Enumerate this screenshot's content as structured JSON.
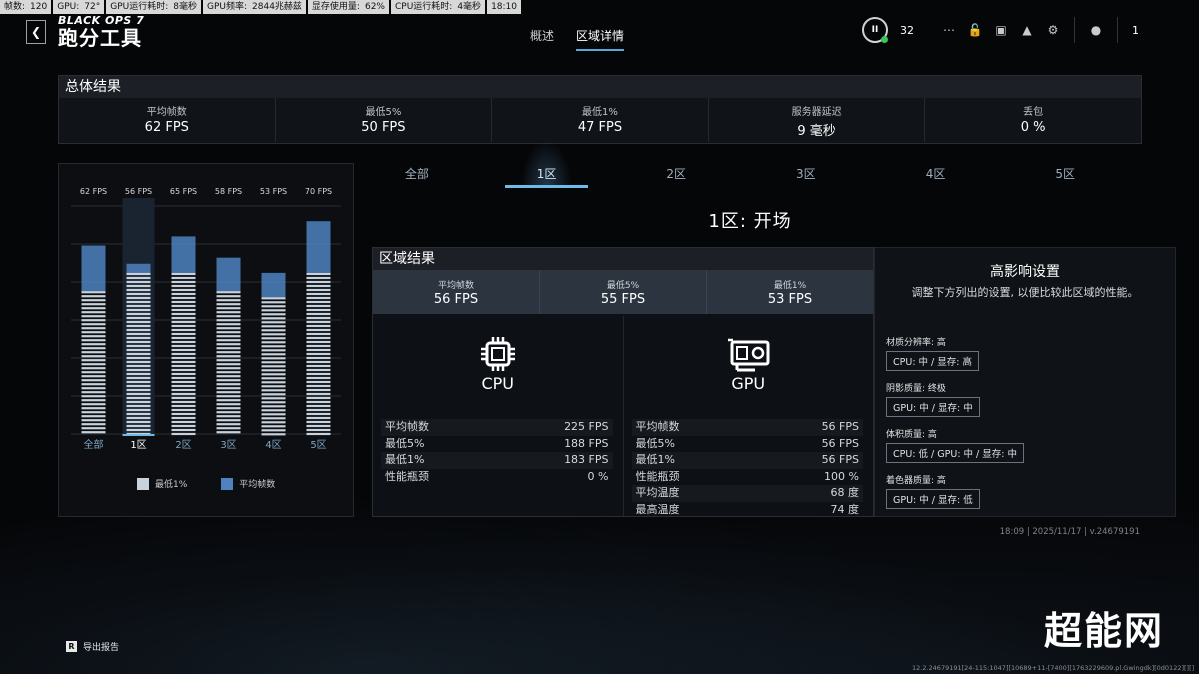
{
  "perf_overlay": [
    {
      "label": "帧数:",
      "value": "120"
    },
    {
      "label": "GPU:",
      "value": "72°"
    },
    {
      "label": "GPU运行耗时:",
      "value": "8毫秒"
    },
    {
      "label": "GPU频率:",
      "value": "2844兆赫兹"
    },
    {
      "label": "显存使用量:",
      "value": "62%"
    },
    {
      "label": "CPU运行耗时:",
      "value": "4毫秒"
    },
    {
      "label": "",
      "value": "18:10"
    }
  ],
  "header": {
    "brand": "BLACK OPS 7",
    "title": "跑分工具",
    "back_icon": "chevron-left-icon",
    "tabs": [
      {
        "label": "概述",
        "active": false
      },
      {
        "label": "区域详情",
        "active": true
      }
    ],
    "rank_badge": "II",
    "rank_number": "32",
    "icons": [
      "grid-icon",
      "lock-icon",
      "camera-icon",
      "bell-icon",
      "gear-icon"
    ],
    "party_count": "1"
  },
  "overall": {
    "title": "总体结果",
    "stats": [
      {
        "label": "平均帧数",
        "value": "62 FPS"
      },
      {
        "label": "最低5%",
        "value": "50 FPS"
      },
      {
        "label": "最低1%",
        "value": "47 FPS"
      },
      {
        "label": "服务器延迟",
        "value": "9 毫秒"
      },
      {
        "label": "丢包",
        "value": "0 %"
      }
    ]
  },
  "chart_data": {
    "type": "bar",
    "categories": [
      "全部",
      "1区",
      "2区",
      "3区",
      "4区",
      "5区"
    ],
    "top_labels": [
      "62 FPS",
      "56 FPS",
      "65 FPS",
      "58 FPS",
      "53 FPS",
      "70 FPS"
    ],
    "series": [
      {
        "name": "最低1%",
        "values": [
          47,
          53,
          53,
          47,
          45,
          53
        ],
        "color": "#c8d2dc"
      },
      {
        "name": "平均帧数",
        "values": [
          62,
          56,
          65,
          58,
          53,
          70
        ],
        "color": "#4f82c0"
      }
    ],
    "selected": 1,
    "ylim": [
      0,
      75
    ]
  },
  "zone_tabs": [
    {
      "label": "全部",
      "active": false
    },
    {
      "label": "1区",
      "active": true
    },
    {
      "label": "2区",
      "active": false
    },
    {
      "label": "3区",
      "active": false
    },
    {
      "label": "4区",
      "active": false
    },
    {
      "label": "5区",
      "active": false
    }
  ],
  "zone_title": "1区:  开场",
  "zone_results": {
    "title": "区域结果",
    "stats": [
      {
        "label": "平均帧数",
        "value": "56 FPS"
      },
      {
        "label": "最低5%",
        "value": "55 FPS"
      },
      {
        "label": "最低1%",
        "value": "53 FPS"
      }
    ],
    "cpu": {
      "name": "CPU",
      "stats": [
        {
          "label": "平均帧数",
          "value": "225 FPS"
        },
        {
          "label": "最低5%",
          "value": "188 FPS"
        },
        {
          "label": "最低1%",
          "value": "183 FPS"
        },
        {
          "label": "性能瓶颈",
          "value": "0 %"
        }
      ]
    },
    "gpu": {
      "name": "GPU",
      "stats": [
        {
          "label": "平均帧数",
          "value": "56 FPS"
        },
        {
          "label": "最低5%",
          "value": "56 FPS"
        },
        {
          "label": "最低1%",
          "value": "56 FPS"
        },
        {
          "label": "性能瓶颈",
          "value": "100 %"
        },
        {
          "label": "平均温度",
          "value": "68 度"
        },
        {
          "label": "最高温度",
          "value": "74 度"
        }
      ]
    }
  },
  "high_impact": {
    "title": "高影响设置",
    "desc": "调整下方列出的设置, 以便比较此区域的性能。",
    "settings": [
      {
        "label": "材质分辨率: 高",
        "value": "CPU: 中 / 显存: 高"
      },
      {
        "label": "阴影质量: 终极",
        "value": "GPU: 中 / 显存: 中"
      },
      {
        "label": "体积质量: 高",
        "value": "CPU: 低 / GPU: 中 / 显存: 中"
      },
      {
        "label": "着色器质量: 高",
        "value": "GPU: 中 / 显存: 低"
      }
    ]
  },
  "footer": {
    "version": "18:09 | 2025/11/17 | v.24679191",
    "export_key": "R",
    "export_label": "导出报告",
    "watermark": "超能网",
    "build": "12.2.24679191[24-115:1047][10689+11-[7400][1763229609.pl.Gwingdk][0d0122][][]"
  },
  "colors": {
    "accent": "#6fbbe8",
    "bar_low": "#c8d2dc",
    "bar_avg": "#4f82c0"
  }
}
